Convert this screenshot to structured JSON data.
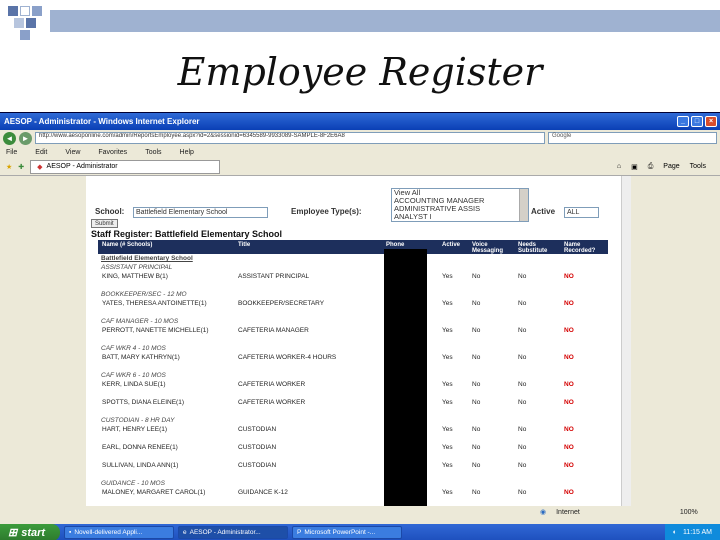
{
  "slide_title": "Employee Register",
  "window": {
    "title": "AESOP - Administrator - Windows Internet Explorer",
    "url": "http://www.aesoponline.com/admin/ReportsEmployee.aspx?id=2&sessionid=6345589-9933089-SAMPLE-8F2E6A8",
    "search_placeholder": "Google",
    "menu": [
      "File",
      "Edit",
      "View",
      "Favorites",
      "Tools",
      "Help"
    ],
    "tab_label": "AESOP - Administrator",
    "tools": [
      "Page",
      "Tools"
    ]
  },
  "filters": {
    "school_label": "School:",
    "school_value": "Battlefield Elementary School",
    "type_label": "Employee Type(s):",
    "type_options": [
      "View All",
      "ACCOUNTING MANAGER",
      "ADMINISTRATIVE ASSIS",
      "ANALYST I"
    ],
    "active_label": "Active",
    "active_value": "ALL",
    "submit_label": "Submit"
  },
  "register_title": "Staff Register: Battlefield Elementary School",
  "columns": {
    "name": "Name (# Schools)",
    "title": "Title",
    "phone": "Phone",
    "active": "Active",
    "voice": "Voice Messaging",
    "needs": "Needs Substitute",
    "name2": "Name Recorded?"
  },
  "school_group": "Battlefield Elementary School",
  "groups": [
    {
      "heading": "ASSISTANT PRINCIPAL",
      "rows": [
        {
          "name": "KING, MATTHEW B(1)",
          "title": "ASSISTANT PRINCIPAL",
          "active": "Yes",
          "voice": "No",
          "needs": "No",
          "recorded": "NO"
        }
      ]
    },
    {
      "heading": "BOOKKEEPER/SEC - 12 MO",
      "rows": [
        {
          "name": "YATES, THERESA ANTOINETTE(1)",
          "title": "BOOKKEEPER/SECRETARY",
          "active": "Yes",
          "voice": "No",
          "needs": "No",
          "recorded": "NO"
        }
      ]
    },
    {
      "heading": "CAF MANAGER - 10 MOS",
      "rows": [
        {
          "name": "PERROTT, NANETTE MICHELLE(1)",
          "title": "CAFETERIA MANAGER",
          "active": "Yes",
          "voice": "No",
          "needs": "No",
          "recorded": "NO"
        }
      ]
    },
    {
      "heading": "CAF WKR 4 - 10 MOS",
      "rows": [
        {
          "name": "BATT, MARY KATHRYN(1)",
          "title": "CAFETERIA WORKER-4 HOURS",
          "active": "Yes",
          "voice": "No",
          "needs": "No",
          "recorded": "NO"
        }
      ]
    },
    {
      "heading": "CAF WKR 6 - 10 MOS",
      "rows": [
        {
          "name": "KERR, LINDA SUE(1)",
          "title": "CAFETERIA WORKER",
          "active": "Yes",
          "voice": "No",
          "needs": "No",
          "recorded": "NO"
        },
        {
          "name": "SPOTTS, DIANA ELEINE(1)",
          "title": "CAFETERIA WORKER",
          "active": "Yes",
          "voice": "No",
          "needs": "No",
          "recorded": "NO"
        }
      ]
    },
    {
      "heading": "CUSTODIAN - 8 HR DAY",
      "rows": [
        {
          "name": "HART, HENRY LEE(1)",
          "title": "CUSTODIAN",
          "active": "Yes",
          "voice": "No",
          "needs": "No",
          "recorded": "NO"
        },
        {
          "name": "EARL, DONNA RENEE(1)",
          "title": "CUSTODIAN",
          "active": "Yes",
          "voice": "No",
          "needs": "No",
          "recorded": "NO"
        },
        {
          "name": "SULLIVAN, LINDA ANN(1)",
          "title": "CUSTODIAN",
          "active": "Yes",
          "voice": "No",
          "needs": "No",
          "recorded": "NO"
        }
      ]
    },
    {
      "heading": "GUIDANCE - 10 MOS",
      "rows": [
        {
          "name": "MALONEY, MARGARET CAROL(1)",
          "title": "GUIDANCE K-12",
          "active": "Yes",
          "voice": "No",
          "needs": "No",
          "recorded": "NO"
        }
      ]
    }
  ],
  "status": {
    "zone": "Internet",
    "zoom": "100%"
  },
  "taskbar": {
    "start_label": "start",
    "tasks": [
      "Novell-delivered Appli...",
      "AESOP - Administrator...",
      "Microsoft PowerPoint -..."
    ],
    "clock": "11:15 AM"
  },
  "colors": {
    "deco_bar": "#9fb2d1",
    "table_header": "#1d2f5c",
    "no_text": "#d40000"
  }
}
